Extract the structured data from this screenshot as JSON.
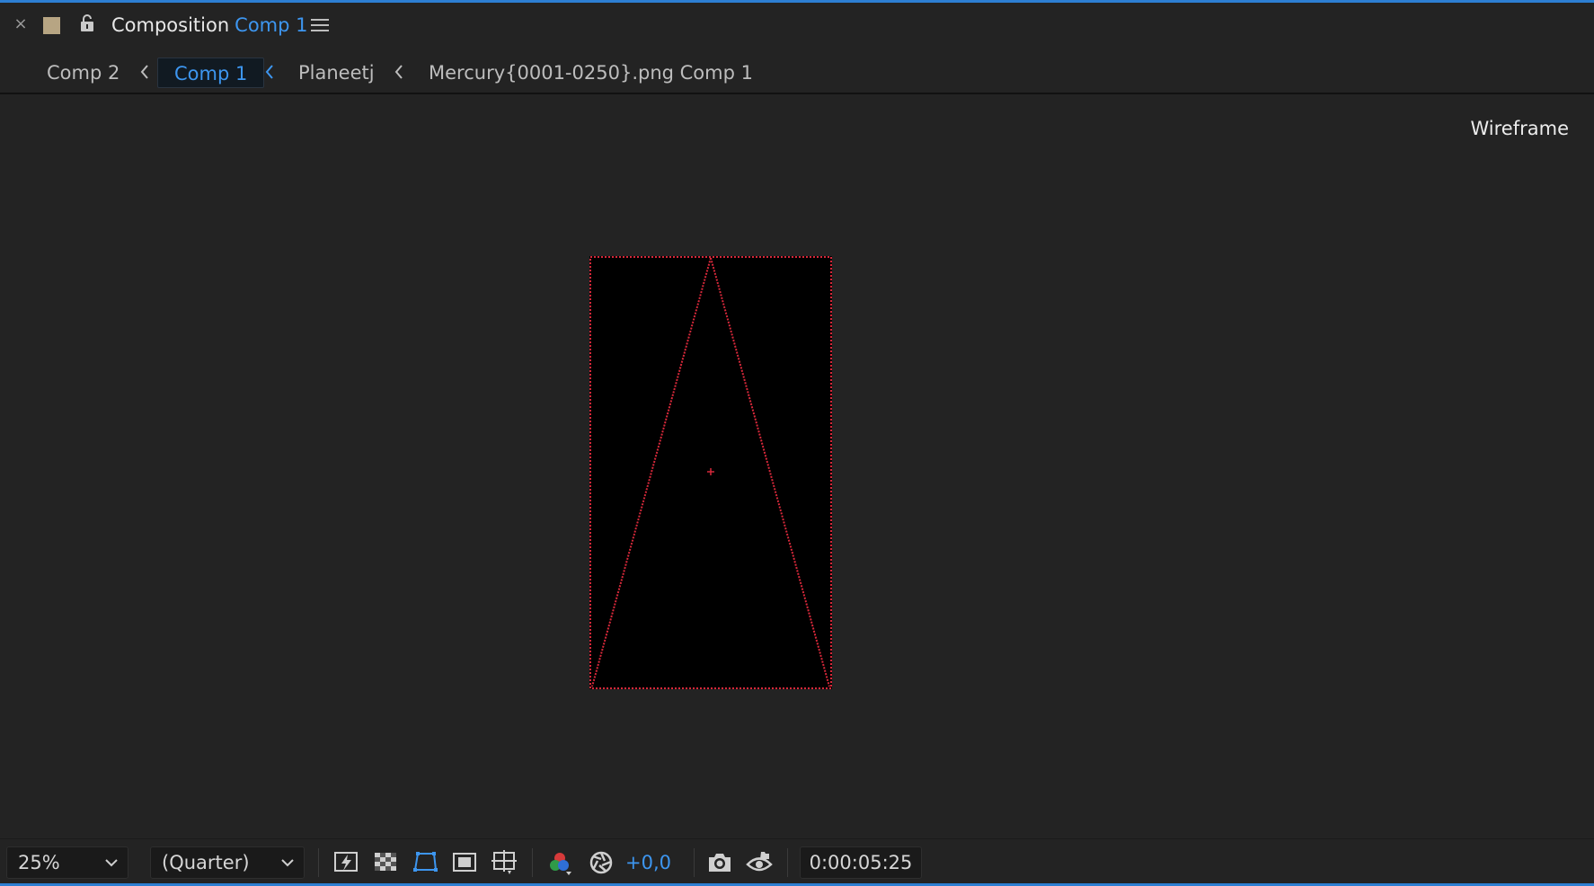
{
  "colors": {
    "accent": "#3d96f0",
    "label_swatch": "#b7a583",
    "wireframe": "#d6283a"
  },
  "header": {
    "close_glyph": "×",
    "title_prefix": "Composition",
    "comp_name": "Comp 1"
  },
  "breadcrumbs": [
    {
      "label": "Comp 2",
      "active": false
    },
    {
      "label": "Comp 1",
      "active": true
    },
    {
      "label": "Planeetj",
      "active": false
    },
    {
      "label": "Mercury{0001-0250}.png Comp 1",
      "active": false
    }
  ],
  "viewer": {
    "render_mode": "Wireframe"
  },
  "toolbar": {
    "magnification": "25%",
    "resolution": "(Quarter)",
    "exposure": "+0,0",
    "timecode": "0:00:05:25",
    "icons": [
      "fast-previews-icon",
      "transparency-grid-icon",
      "mask-path-visibility-icon",
      "region-of-interest-icon",
      "grid-guides-icon",
      "channel-rgb-icon",
      "reset-exposure-icon",
      "snapshot-camera-icon",
      "show-snapshot-icon"
    ]
  }
}
